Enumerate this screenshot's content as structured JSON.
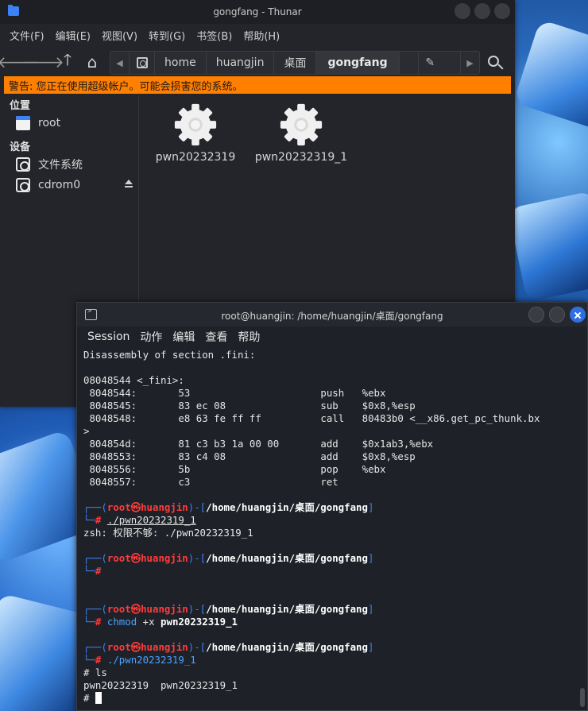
{
  "thunar": {
    "title": "gongfang - Thunar",
    "menus": [
      "文件(F)",
      "编辑(E)",
      "视图(V)",
      "转到(G)",
      "书签(B)",
      "帮助(H)"
    ],
    "breadcrumbs": [
      "home",
      "huangjin",
      "桌面",
      "gongfang"
    ],
    "warning": "警告: 您正在使用超级帐户。可能会损害您的系统。",
    "sidebar": {
      "places_heading": "位置",
      "root_label": "root",
      "devices_heading": "设备",
      "filesystem_label": "文件系统",
      "cdrom_label": "cdrom0"
    },
    "files": [
      "pwn20232319",
      "pwn20232319_1"
    ]
  },
  "terminal": {
    "title": "root@huangjin: /home/huangjin/桌面/gongfang",
    "menus": [
      "Session",
      "动作",
      "编辑",
      "查看",
      "帮助"
    ],
    "disasm": {
      "header": "Disassembly of section .fini:",
      "func": "08048544 <_fini>:",
      "lines": [
        " 8048544:       53                      push   %ebx",
        " 8048545:       83 ec 08                sub    $0x8,%esp",
        " 8048548:       e8 63 fe ff ff          call   80483b0 <__x86.get_pc_thunk.bx",
        ">",
        " 804854d:       81 c3 b3 1a 00 00       add    $0x1ab3,%ebx",
        " 8048553:       83 c4 08                add    $0x8,%esp",
        " 8048556:       5b                      pop    %ebx",
        " 8048557:       c3                      ret"
      ]
    },
    "prompt": {
      "open": "┌──(",
      "user": "root",
      "at": "㉿",
      "host": "huangjin",
      "mid": ")-[",
      "path": "/home/huangjin/桌面/gongfang",
      "close": "]",
      "second": "└─",
      "hash": "#"
    },
    "cmd1": "./pwn20232319_1",
    "err1": "zsh: 权限不够: ./pwn20232319_1",
    "cmd3_name": "chmod",
    "cmd3_arg1": "+x",
    "cmd3_arg2": "pwn20232319_1",
    "cmd4": "./pwn20232319_1",
    "ls_line": "# ls",
    "ls_out": "pwn20232319  pwn20232319_1",
    "last_prompt": "# "
  }
}
